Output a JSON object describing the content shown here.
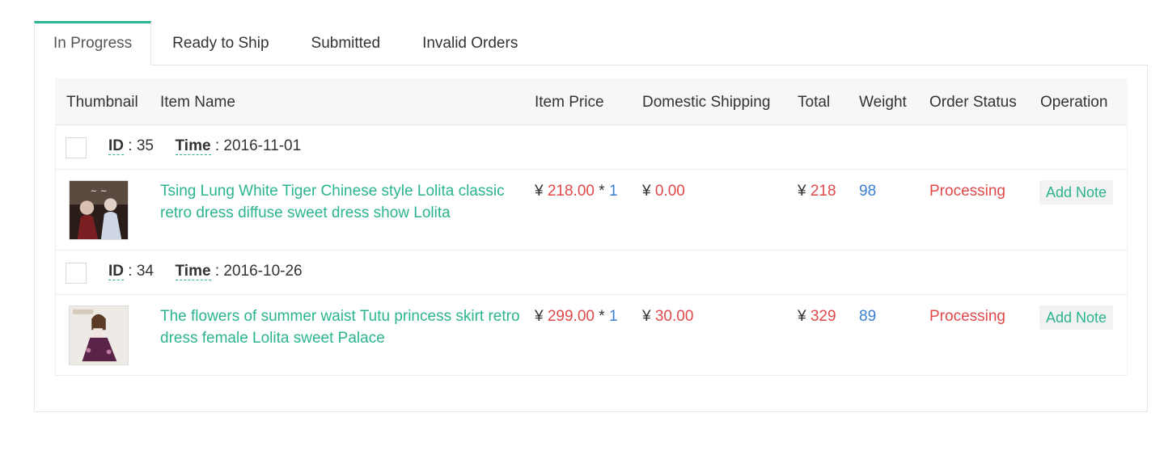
{
  "tabs": [
    {
      "label": "In Progress"
    },
    {
      "label": "Ready to Ship"
    },
    {
      "label": "Submitted"
    },
    {
      "label": "Invalid Orders"
    }
  ],
  "table": {
    "headers": {
      "thumbnail": "Thumbnail",
      "item_name": "Item Name",
      "item_price": "Item Price",
      "domestic_shipping": "Domestic Shipping",
      "total": "Total",
      "weight": "Weight",
      "order_status": "Order Status",
      "operation": "Operation"
    },
    "orders": [
      {
        "id_label": "ID",
        "id": "35",
        "time_label": "Time",
        "time": "2016-11-01",
        "item_name": "Tsing Lung White Tiger Chinese style Lolita classic retro dress diffuse sweet dress show Lolita",
        "currency": "¥",
        "price": "218.00",
        "qty_sep": "*",
        "qty": "1",
        "shipping": "0.00",
        "total": "218",
        "weight": "98",
        "status": "Processing",
        "action": "Add Note"
      },
      {
        "id_label": "ID",
        "id": "34",
        "time_label": "Time",
        "time": "2016-10-26",
        "item_name": "The flowers of summer waist Tutu princess skirt retro dress female Lolita sweet Palace",
        "currency": "¥",
        "price": "299.00",
        "qty_sep": "*",
        "qty": "1",
        "shipping": "30.00",
        "total": "329",
        "weight": "89",
        "status": "Processing",
        "action": "Add Note"
      }
    ]
  },
  "colors": {
    "accent": "#2bb48f",
    "price_red": "#e0484a",
    "value_blue": "#3a7fd0"
  }
}
